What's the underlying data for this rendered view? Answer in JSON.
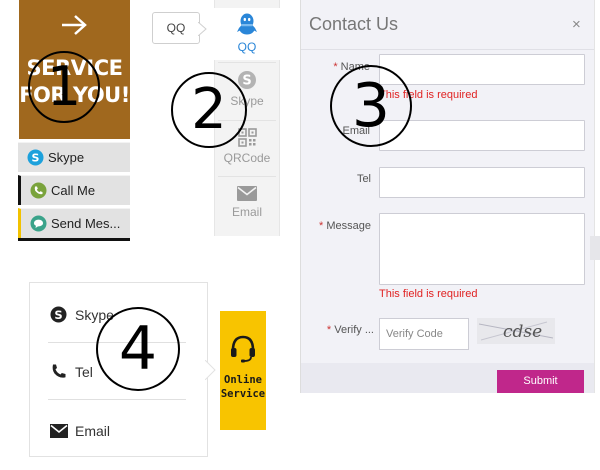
{
  "widget1": {
    "banner_text": "SERVICE\nFOR YOU!",
    "items": [
      {
        "label": "Skype",
        "icon": "skype-icon"
      },
      {
        "label": "Call Me",
        "icon": "phone-icon"
      },
      {
        "label": "Send Mes...",
        "icon": "message-icon"
      }
    ],
    "colors": {
      "banner": "#a0681e",
      "row": "#e2e2e2",
      "accent": "#f2c200"
    }
  },
  "widget2": {
    "tooltip": "QQ",
    "items": [
      {
        "label": "QQ",
        "icon": "qq-penguin-icon"
      },
      {
        "label": "Skype",
        "icon": "skype-icon"
      },
      {
        "label": "QRCode",
        "icon": "qrcode-icon"
      },
      {
        "label": "Email",
        "icon": "envelope-icon"
      }
    ],
    "colors": {
      "active": "#2a86d8",
      "bar": "#f3f3f3"
    }
  },
  "widget3": {
    "title": "Contact Us",
    "close": "×",
    "fields": {
      "name_label": "Name",
      "email_label": "Email",
      "tel_label": "Tel",
      "message_label": "Message",
      "verify_label": "Verify ...",
      "required_marker": "*"
    },
    "error_text": "This field is required",
    "verify_placeholder": "Verify Code",
    "captcha_text": "cdse",
    "submit": "Submit",
    "colors": {
      "submit": "#c0278b",
      "error": "#e02222"
    }
  },
  "widget4": {
    "items": [
      {
        "label": "Skype",
        "icon": "skype-icon"
      },
      {
        "label": "Tel",
        "icon": "phone-icon"
      },
      {
        "label": "Email",
        "icon": "envelope-icon"
      }
    ],
    "button_text": "Online\nService",
    "colors": {
      "button": "#f8c400"
    }
  },
  "annotations": {
    "n1": "1",
    "n2": "2",
    "n3": "3",
    "n4": "4"
  }
}
